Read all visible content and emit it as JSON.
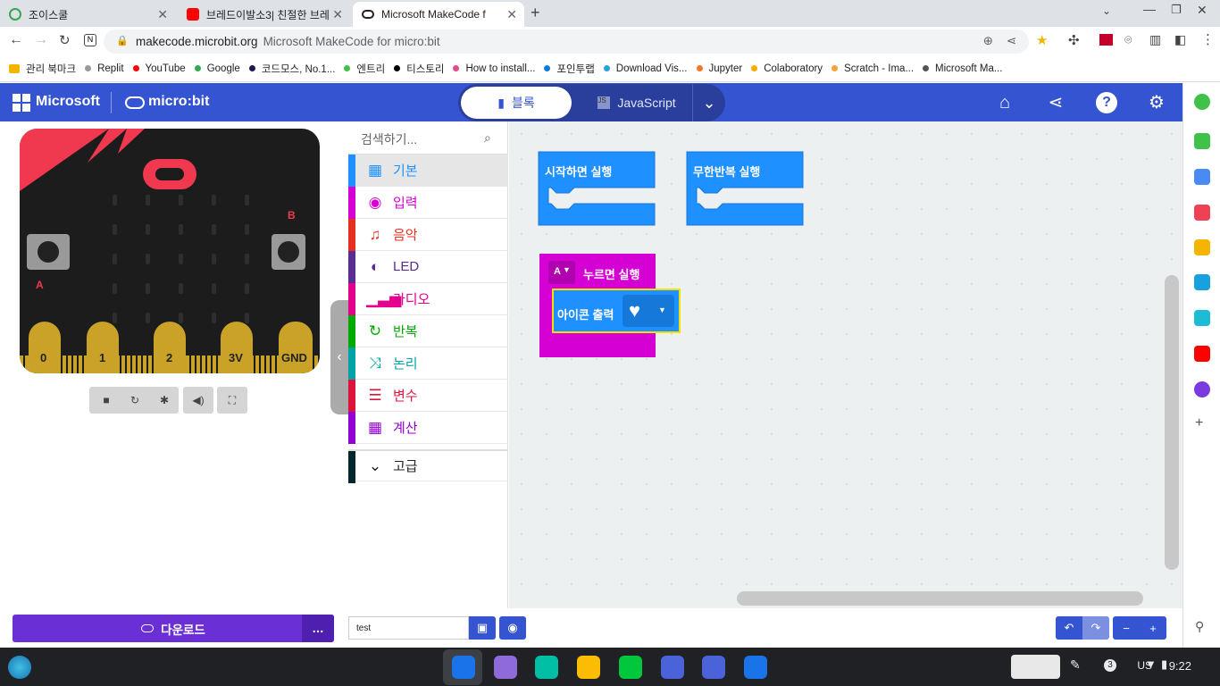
{
  "tabs": [
    {
      "title": "조이스쿨",
      "favicon_color": "#34a853"
    },
    {
      "title": "브레드이발소3| 친절한 브레",
      "favicon_color": "#ff0000"
    },
    {
      "title": "Microsoft MakeCode f",
      "favicon_color": "#202124"
    }
  ],
  "address": {
    "domain": "makecode.microbit.org",
    "page_title": "Microsoft MakeCode for micro:bit"
  },
  "bookmarks": [
    {
      "label": "관리 북마크",
      "color": "#f4b400"
    },
    {
      "label": "Replit",
      "color": "#999"
    },
    {
      "label": "YouTube",
      "color": "#ff0000"
    },
    {
      "label": "Google",
      "color": "#34a853"
    },
    {
      "label": "코드모스, No.1...",
      "color": "#1a1a4e"
    },
    {
      "label": "엔트리",
      "color": "#3fc14a"
    },
    {
      "label": "티스토리",
      "color": "#000"
    },
    {
      "label": "How to install...",
      "color": "#e34c8c"
    },
    {
      "label": "포인투랩",
      "color": "#0a7cd8"
    },
    {
      "label": "Download Vis...",
      "color": "#2aa0e0"
    },
    {
      "label": "Jupyter",
      "color": "#f37726"
    },
    {
      "label": "Colaboratory",
      "color": "#f9ab00"
    },
    {
      "label": "Scratch - Ima...",
      "color": "#f7a233"
    },
    {
      "label": "Microsoft Ma...",
      "color": "#555"
    }
  ],
  "header": {
    "brand": "Microsoft",
    "product": "micro:bit",
    "tab_blocks": "블록",
    "tab_js": "JavaScript"
  },
  "search_placeholder": "검색하기...",
  "categories": [
    {
      "label": "기본",
      "color": "#1e90ff",
      "icon": "▦"
    },
    {
      "label": "입력",
      "color": "#d400d4",
      "icon": "◉"
    },
    {
      "label": "음악",
      "color": "#e63022",
      "icon": "♫"
    },
    {
      "label": "LED",
      "color": "#5c2d91",
      "icon": "◐"
    },
    {
      "label": "라디오",
      "color": "#e3008c",
      "icon": "▁▃▅"
    },
    {
      "label": "반복",
      "color": "#00aa00",
      "icon": "↻"
    },
    {
      "label": "논리",
      "color": "#00a4a6",
      "icon": "⤨"
    },
    {
      "label": "변수",
      "color": "#dc143c",
      "icon": "☰"
    },
    {
      "label": "계산",
      "color": "#9400d3",
      "icon": "▦"
    },
    {
      "label": "고급",
      "color": "#00272b",
      "icon": "⌄"
    }
  ],
  "blocks": {
    "on_start": "시작하면 실행",
    "forever": "무한반복 실행",
    "button": "A",
    "on_pressed": "누르면 실행",
    "show_icon": "아이콘 출력"
  },
  "pins": [
    "0",
    "1",
    "2",
    "3V",
    "GND"
  ],
  "board_buttons": {
    "a": "A",
    "b": "B"
  },
  "download_label": "다운로드",
  "project_name": "test",
  "shelf": {
    "keyboard": "US",
    "notif_count": "3",
    "time": "9:22"
  }
}
